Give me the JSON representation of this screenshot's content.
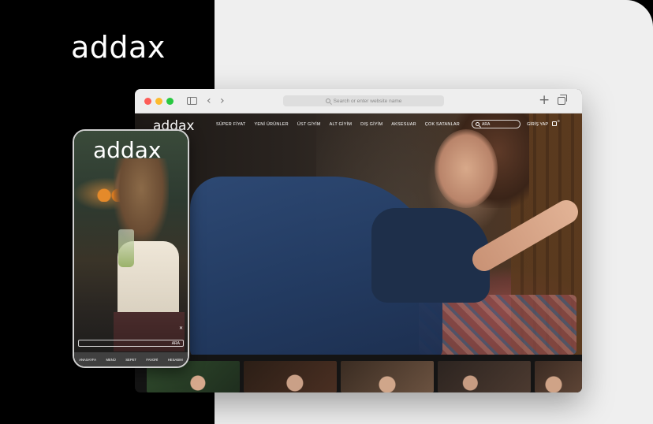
{
  "brand": {
    "logo_text": "addax"
  },
  "browser": {
    "address_placeholder": "Search or enter website name",
    "icons": [
      "sidebar-icon",
      "back-arrow-icon",
      "forward-arrow-icon",
      "search-icon",
      "plus-icon",
      "tabs-icon"
    ],
    "nav_back": "‹",
    "nav_forward": "›",
    "plus": "+"
  },
  "site": {
    "logo_text": "addax",
    "nav": [
      "SÜPER FİYAT",
      "YENİ ÜRÜNLER",
      "ÜST GİYİM",
      "ALT GİYİM",
      "DIŞ GİYİM",
      "AKSESUAR",
      "ÇOK SATANLAR"
    ],
    "search_label": "ARA",
    "login_label": "GİRİŞ YAP",
    "cart_count": "0"
  },
  "phone": {
    "logo_text": "addax",
    "search_label": "ARA",
    "close_glyph": "✕",
    "nav": [
      "ANASAYFA",
      "MENÜ",
      "SEPET",
      "FAVORİ",
      "HESABIM"
    ]
  },
  "colors": {
    "left_bg": "#000000",
    "right_bg": "#efefef",
    "traffic_red": "#fd5c57",
    "traffic_yellow": "#fcbb2e",
    "traffic_green": "#28c840"
  }
}
